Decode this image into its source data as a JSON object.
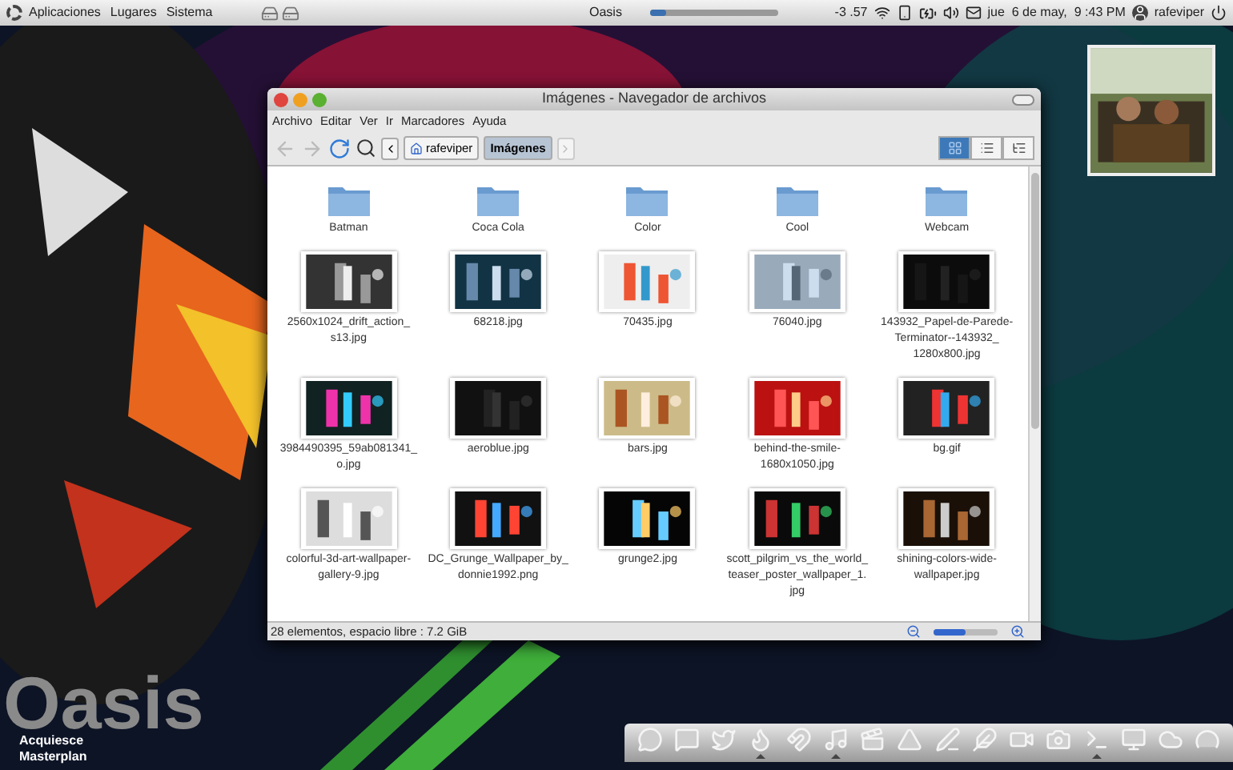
{
  "top_panel": {
    "menus": [
      "Aplicaciones",
      "Lugares",
      "Sistema"
    ],
    "title": "Oasis",
    "volume": {
      "level": 0.12
    },
    "reading": "-3 .57",
    "clock": "jue  6 de may,  9 :43 PM",
    "user": "rafeviper"
  },
  "window": {
    "title": "Imágenes - Navegador de archivos",
    "menu": [
      "Archivo",
      "Editar",
      "Ver",
      "Ir",
      "Marcadores",
      "Ayuda"
    ],
    "path": [
      {
        "label": "rafeviper",
        "selected": false
      },
      {
        "label": "Imágenes",
        "selected": true
      }
    ],
    "views": [
      {
        "kind": "icons",
        "selected": true
      },
      {
        "kind": "list",
        "selected": false
      },
      {
        "kind": "compact",
        "selected": false
      }
    ],
    "items": [
      {
        "kind": "folder",
        "name": "Batman"
      },
      {
        "kind": "folder",
        "name": "Coca Cola"
      },
      {
        "kind": "folder",
        "name": "Color"
      },
      {
        "kind": "folder",
        "name": "Cool"
      },
      {
        "kind": "folder",
        "name": "Webcam"
      },
      {
        "name": "2560x1024_drift_action_ s13.jpg"
      },
      {
        "name": "68218.jpg"
      },
      {
        "name": "70435.jpg"
      },
      {
        "name": "76040.jpg"
      },
      {
        "name": "143932_Papel-de-Parede- Terminator--143932_ 1280x800.jpg"
      },
      {
        "name": "3984490395_59ab081341_ o.jpg"
      },
      {
        "name": "aeroblue.jpg"
      },
      {
        "name": "bars.jpg"
      },
      {
        "name": "behind-the-smile- 1680x1050.jpg"
      },
      {
        "name": "bg.gif"
      },
      {
        "name": "colorful-3d-art-wallpaper- gallery-9.jpg"
      },
      {
        "name": "DC_Grunge_Wallpaper_by_ donnie1992.png"
      },
      {
        "name": "grunge2.jpg"
      },
      {
        "name": "scott_pilgrim_vs_the_world_ teaser_poster_wallpaper_1. jpg"
      },
      {
        "name": "shining-colors-wide- wallpaper.jpg"
      }
    ],
    "status": "28 elementos, espacio libre : 7.2 GiB",
    "zoom": {
      "level": 0.5
    }
  },
  "desktop": {
    "logo": "Oasis",
    "widget": "Acquiesce Masterplan"
  },
  "dock": [
    {
      "running": false
    },
    {
      "running": false
    },
    {
      "running": false
    },
    {
      "running": true
    },
    {
      "running": false
    },
    {
      "running": true
    },
    {
      "running": false
    },
    {
      "running": false
    },
    {
      "running": false
    },
    {
      "running": false
    },
    {
      "running": false
    },
    {
      "running": false
    },
    {
      "running": true
    },
    {
      "running": false
    },
    {
      "running": false
    },
    {
      "running": false
    }
  ]
}
